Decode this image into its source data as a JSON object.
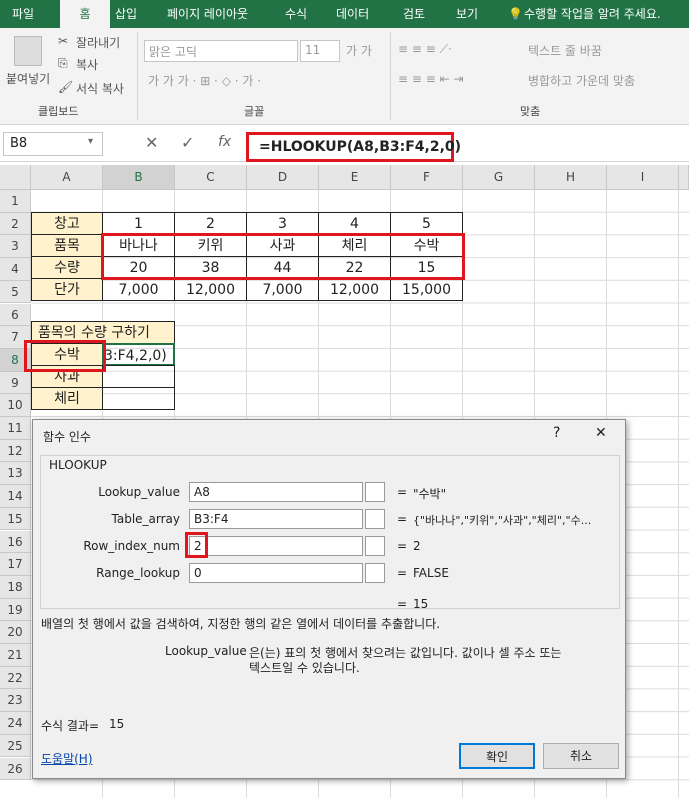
{
  "ribbon_tabs": [
    "파일",
    "홈",
    "삽입",
    "페이지 레이아웃",
    "수식",
    "데이터",
    "검토",
    "보기"
  ],
  "tell_me": "수행할 작업을 알려 주세요.",
  "ribbon": {
    "paste": "붙여넣기",
    "cut": "잘라내기",
    "copy": "복사",
    "format_painter": "서식 복사",
    "clipboard_group": "클립보드",
    "font_name": "맑은 고딕",
    "font_size": "11",
    "font_group": "글꼴",
    "wrap_text": "텍스트 줄 바꿈",
    "merge_center": "병합하고 가운데 맞춤",
    "align_group": "맞춤"
  },
  "name_box": "B8",
  "formula": "=HLOOKUP(A8,B3:F4,2,0)",
  "columns": [
    "A",
    "B",
    "C",
    "D",
    "E",
    "F",
    "G",
    "H",
    "I"
  ],
  "rows": [
    "1",
    "2",
    "3",
    "4",
    "5",
    "6",
    "7",
    "8",
    "9",
    "10",
    "11",
    "12",
    "13",
    "14",
    "15",
    "16",
    "17",
    "18",
    "19",
    "20",
    "21",
    "22",
    "23",
    "24",
    "25",
    "26"
  ],
  "table": {
    "row2": [
      "창고",
      "1",
      "2",
      "3",
      "4",
      "5"
    ],
    "row3": [
      "품목",
      "바나나",
      "키위",
      "사과",
      "체리",
      "수박"
    ],
    "row4": [
      "수량",
      "20",
      "38",
      "44",
      "22",
      "15"
    ],
    "row5": [
      "단가",
      "7,000",
      "12,000",
      "7,000",
      "12,000",
      "15,000"
    ]
  },
  "lookup": {
    "title": "품목의 수량 구하기",
    "a8": "수박",
    "b8": "3:F4,2,0)",
    "a9": "사과",
    "a10": "체리"
  },
  "dialog": {
    "title": "함수 인수",
    "help_q": "?",
    "close": "✕",
    "func": "HLOOKUP",
    "args": [
      {
        "label": "Lookup_value",
        "value": "A8",
        "result": "\"수박\""
      },
      {
        "label": "Table_array",
        "value": "B3:F4",
        "result": "{\"바나나\",\"키위\",\"사과\",\"체리\",\"수..."
      },
      {
        "label": "Row_index_num",
        "value": "2",
        "result": "2"
      },
      {
        "label": "Range_lookup",
        "value": "0",
        "result": "FALSE"
      }
    ],
    "total": "15",
    "description": "배열의 첫 행에서 값을 검색하여, 지정한 행의 같은 열에서 데이터를 추출합니다.",
    "arg_name": "Lookup_value",
    "arg_desc_1": "은(는) 표의 첫 행에서 찾으려는 값입니다. 값이나 셀 주소 또는",
    "arg_desc_2": "텍스트일 수 있습니다.",
    "formula_result_label": "수식 결과=",
    "formula_result": "15",
    "help_link": "도움말(H)",
    "ok": "확인",
    "cancel": "취소"
  }
}
